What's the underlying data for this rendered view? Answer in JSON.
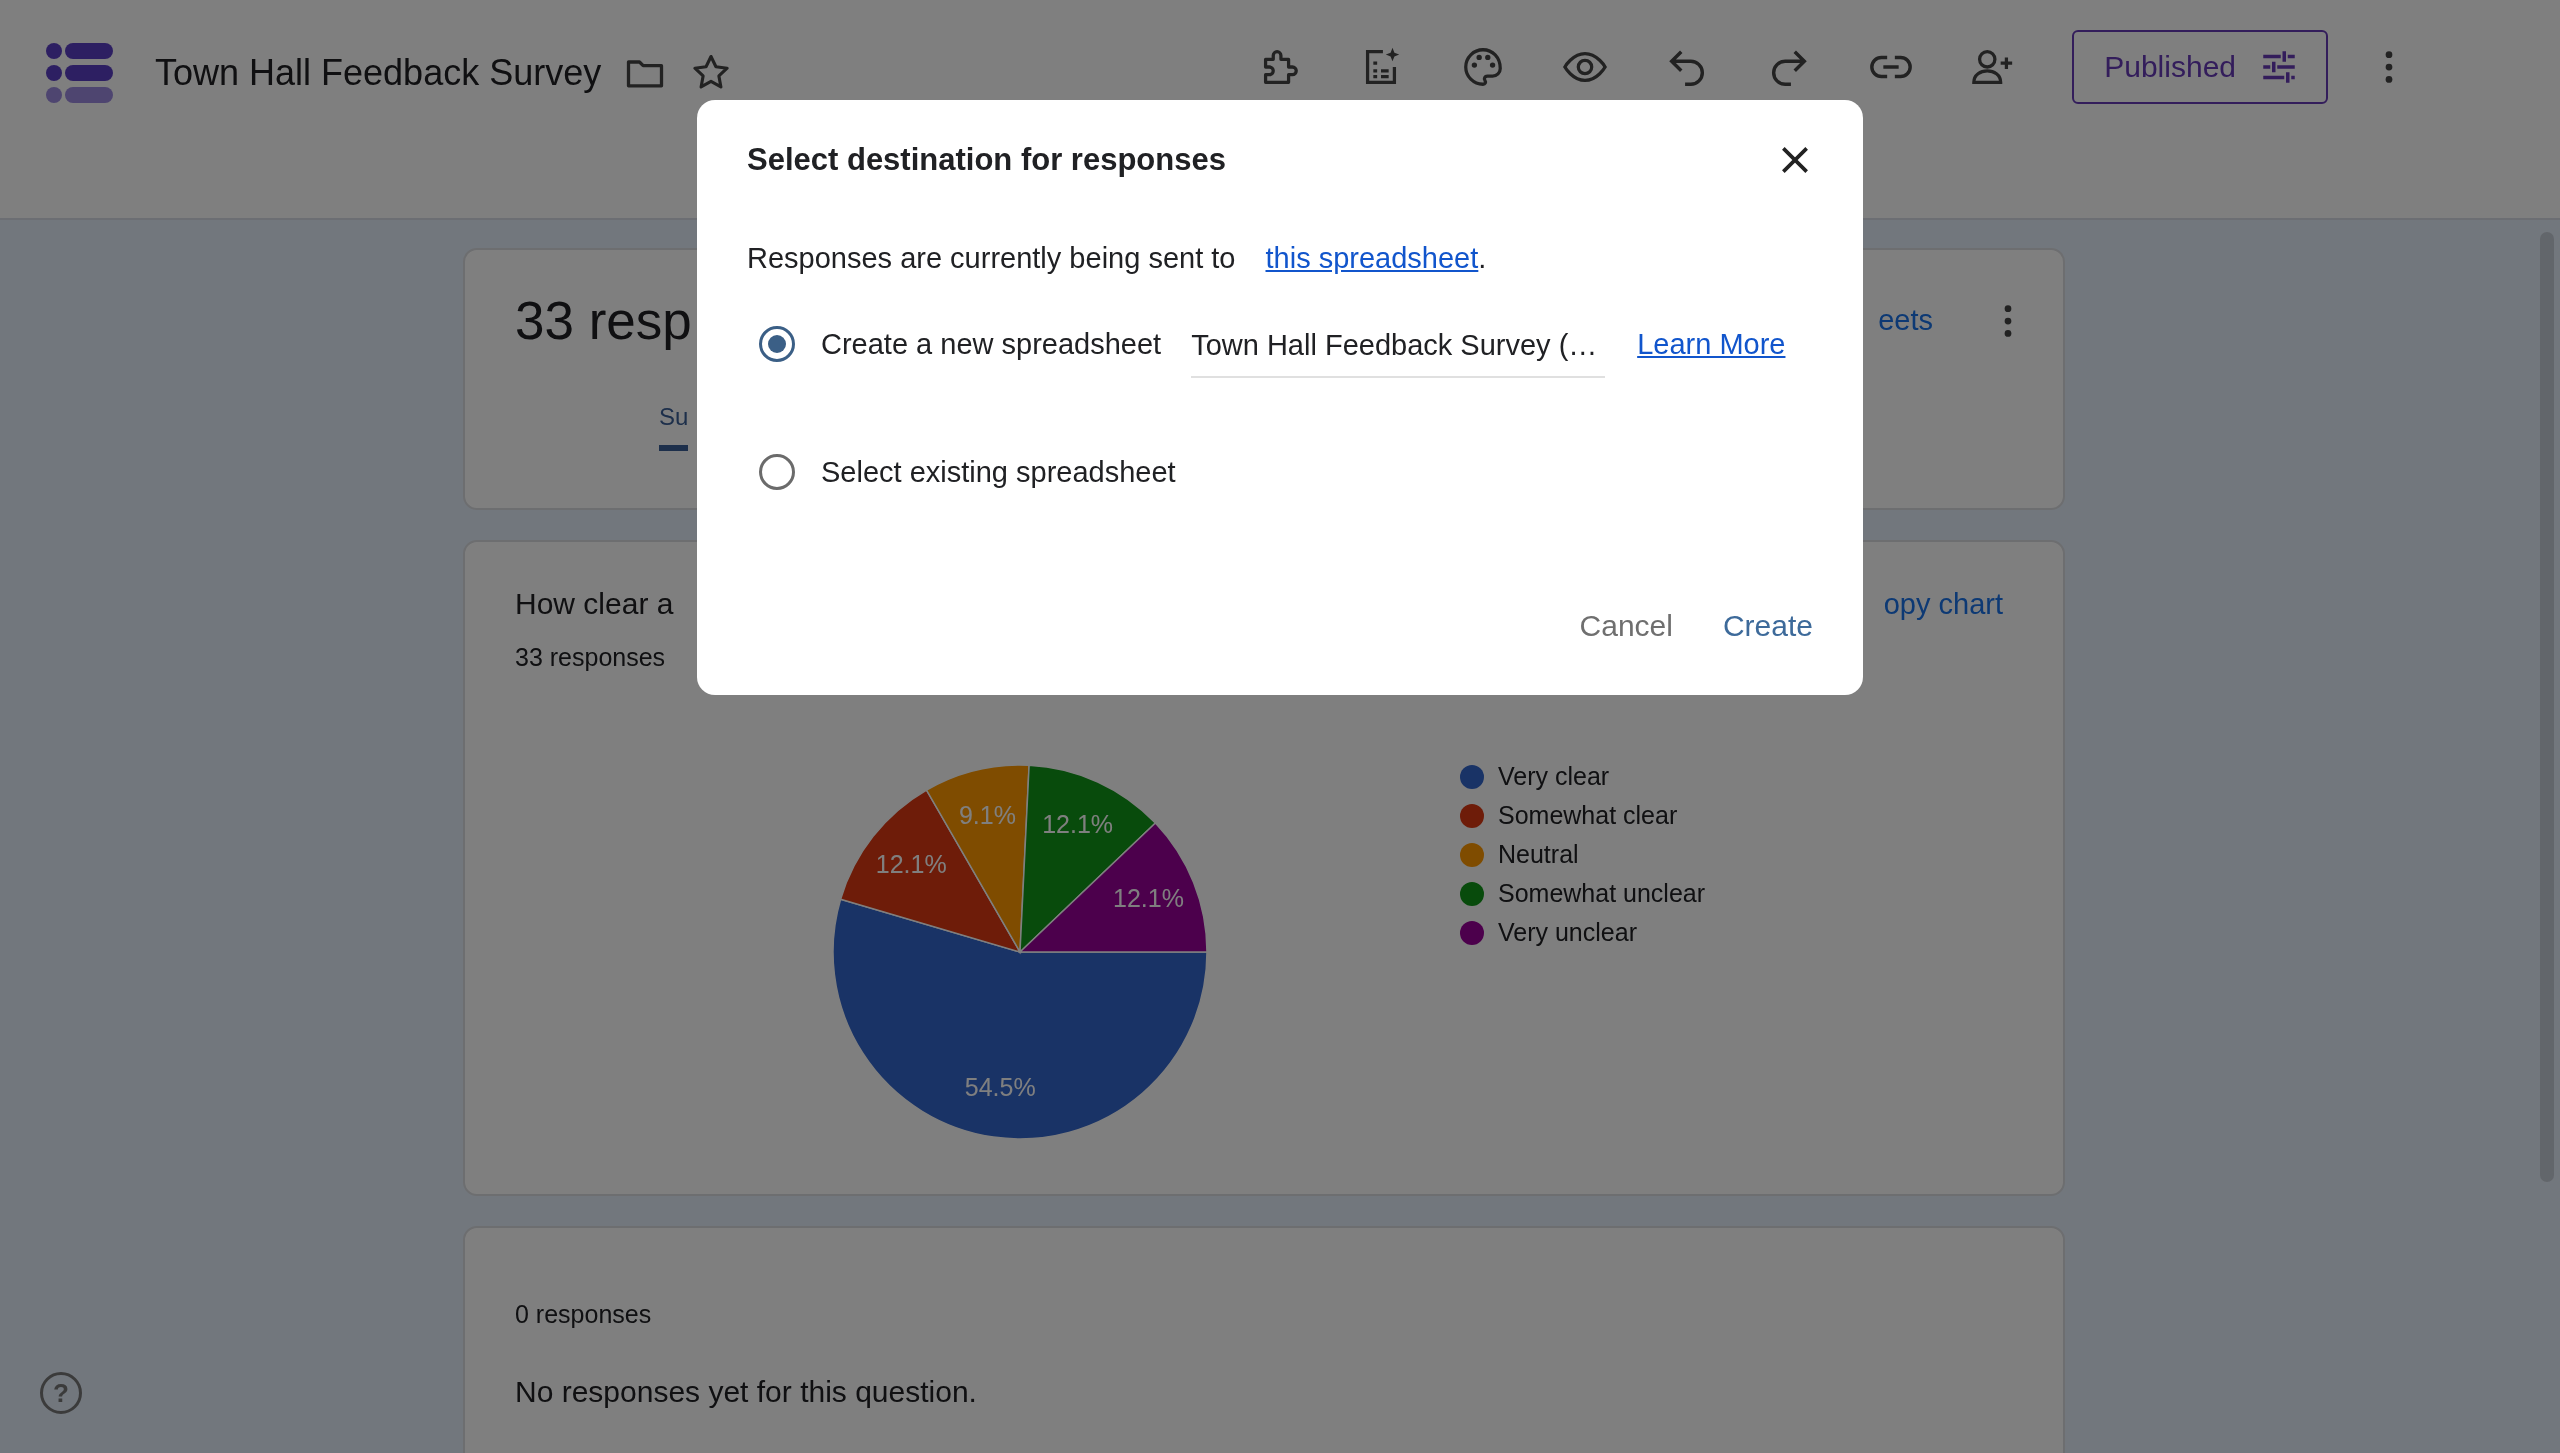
{
  "app": {
    "title": "Town Hall Feedback Survey",
    "publish_button": "Published",
    "help": "?"
  },
  "summary_card": {
    "title": "33 resp",
    "link_button": "eets",
    "tabs": [
      {
        "label": "Su",
        "selected": true
      }
    ]
  },
  "question_card": {
    "title": "How clear a",
    "count": "33 responses",
    "copy_button": "opy chart",
    "chart_data": {
      "type": "pie",
      "categories": [
        "Very clear",
        "Somewhat clear",
        "Neutral",
        "Somewhat unclear",
        "Very unclear"
      ],
      "values": [
        54.5,
        12.1,
        9.1,
        12.1,
        12.1
      ],
      "colors": [
        "#3366cc",
        "#dc3912",
        "#ff9900",
        "#109618",
        "#990099"
      ],
      "data_labels": true,
      "legend": "right",
      "value_labels": [
        "54.5%",
        "12.1%",
        "9.1%",
        "12.1%",
        "12.1%"
      ]
    }
  },
  "empty_card": {
    "count": "0 responses",
    "message": "No responses yet for this question."
  },
  "dialog": {
    "title": "Select destination for responses",
    "sentence": "Responses are currently being sent to",
    "link": "this spreadsheet",
    "after_link": ".",
    "options": [
      {
        "label": "Create a new spreadsheet",
        "selected": true,
        "field_value": "Town Hall Feedback Survey (…",
        "link": "Learn More"
      },
      {
        "label": "Select existing spreadsheet",
        "selected": false
      }
    ],
    "buttons": [
      {
        "label": "Cancel",
        "kind": "secondary"
      },
      {
        "label": "Create",
        "kind": "primary"
      }
    ]
  }
}
